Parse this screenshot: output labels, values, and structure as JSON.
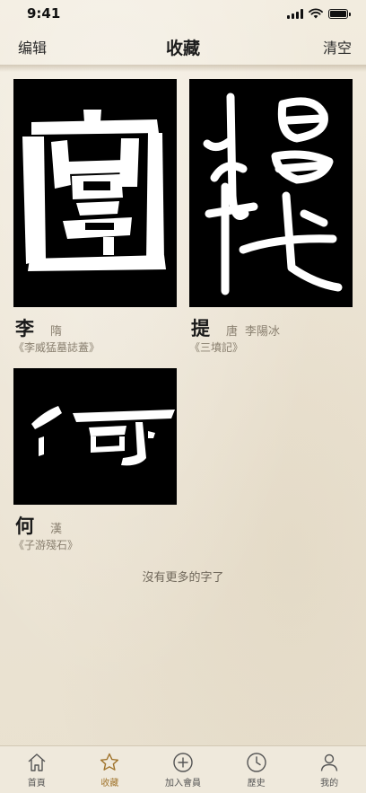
{
  "status_bar": {
    "time": "9:41"
  },
  "nav": {
    "left": "编辑",
    "title": "收藏",
    "right": "清空"
  },
  "cards": [
    {
      "char": "李",
      "dynasty": "隋",
      "author": "",
      "source": "《李威猛墓誌蓋》"
    },
    {
      "char": "提",
      "dynasty": "唐",
      "author": "李陽冰",
      "source": "《三墳記》"
    },
    {
      "char": "何",
      "dynasty": "漢",
      "author": "",
      "source": "《子游殘石》"
    }
  ],
  "footer_message": "沒有更多的字了",
  "tabs": [
    {
      "label": "首頁",
      "icon": "home-icon",
      "active": false
    },
    {
      "label": "收藏",
      "icon": "star-icon",
      "active": true
    },
    {
      "label": "加入會員",
      "icon": "plus-circle-icon",
      "active": false
    },
    {
      "label": "歷史",
      "icon": "clock-icon",
      "active": false
    },
    {
      "label": "我的",
      "icon": "user-icon",
      "active": false
    }
  ],
  "colors": {
    "accent": "#a0742c",
    "background": "#efe8da",
    "card_image": "#000000",
    "secondary_text": "#8a8070"
  }
}
